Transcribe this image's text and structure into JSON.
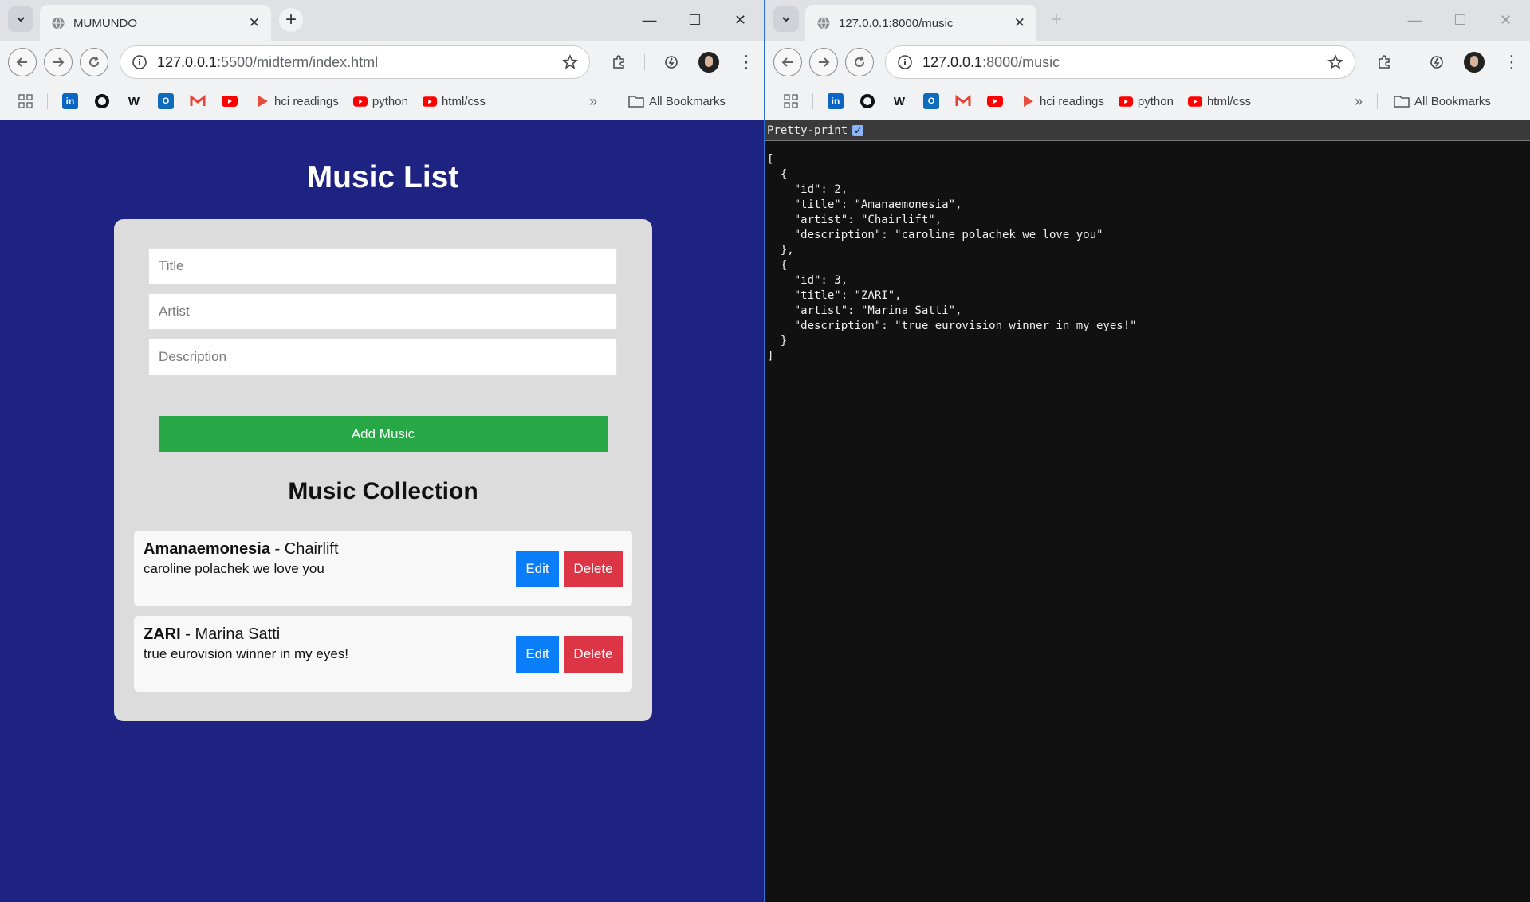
{
  "browser_left": {
    "tab_title": "MUMUNDO",
    "url_host": "127.0.0.1",
    "url_path": ":5500/midterm/index.html"
  },
  "browser_right": {
    "tab_title": "127.0.0.1:8000/music",
    "url_host": "127.0.0.1",
    "url_path": ":8000/music"
  },
  "bookmarks": {
    "items": [
      "hci readings",
      "python",
      "html/css"
    ],
    "all_bookmarks": "All Bookmarks",
    "overflow": "»"
  },
  "app": {
    "title": "Music List",
    "form": {
      "title_placeholder": "Title",
      "artist_placeholder": "Artist",
      "description_placeholder": "Description",
      "add_button": "Add Music"
    },
    "collection_title": "Music Collection",
    "songs": [
      {
        "title": "Amanaemonesia",
        "artist": "Chairlift",
        "description": "caroline polachek we love you"
      },
      {
        "title": "ZARI",
        "artist": "Marina Satti",
        "description": "true eurovision winner in my eyes!"
      }
    ],
    "edit_label": "Edit",
    "delete_label": "Delete",
    "separator": " - "
  },
  "json_view": {
    "pretty_print_label": "Pretty-print",
    "raw": "[\n  {\n    \"id\": 2,\n    \"title\": \"Amanaemonesia\",\n    \"artist\": \"Chairlift\",\n    \"description\": \"caroline polachek we love you\"\n  },\n  {\n    \"id\": 3,\n    \"title\": \"ZARI\",\n    \"artist\": \"Marina Satti\",\n    \"description\": \"true eurovision winner in my eyes!\"\n  }\n]"
  },
  "colors": {
    "page_bg": "#1e2280",
    "card_bg": "#dcdcdc",
    "add_button": "#27a745",
    "edit_button": "#0a7ef8",
    "delete_button": "#dc3545"
  }
}
